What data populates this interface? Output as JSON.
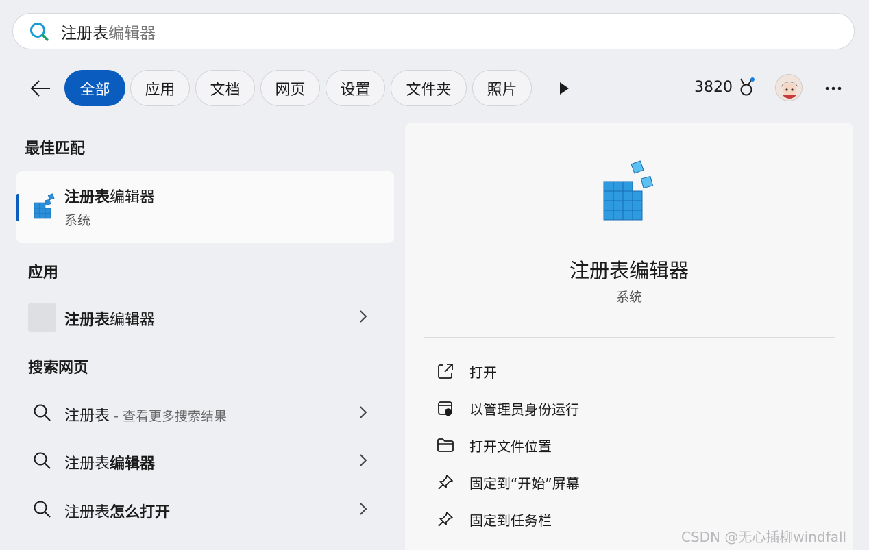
{
  "search": {
    "query_typed": "注册表",
    "query_suggest": "编辑器",
    "value": "注册表编辑器"
  },
  "filters": {
    "chips": [
      {
        "label": "全部",
        "active": true
      },
      {
        "label": "应用"
      },
      {
        "label": "文档"
      },
      {
        "label": "网页"
      },
      {
        "label": "设置"
      },
      {
        "label": "文件夹"
      },
      {
        "label": "照片"
      }
    ],
    "points": "3820"
  },
  "left": {
    "best_match_title": "最佳匹配",
    "best_match": {
      "name_bold": "注册表",
      "name_rest": "编辑器",
      "subtitle": "系统"
    },
    "apps_title": "应用",
    "apps": [
      {
        "name_bold": "注册表",
        "name_rest": "编辑器"
      }
    ],
    "web_title": "搜索网页",
    "web_results": [
      {
        "plain": "注册表",
        "hint": " - 查看更多搜索结果"
      },
      {
        "plain": "注册表",
        "bold": "编辑器"
      },
      {
        "plain": "注册表",
        "bold": "怎么打开"
      }
    ]
  },
  "detail": {
    "name": "注册表编辑器",
    "kind": "系统",
    "actions": [
      {
        "label": "打开",
        "icon": "open-external-icon"
      },
      {
        "label": "以管理员身份运行",
        "icon": "shield-admin-icon"
      },
      {
        "label": "打开文件位置",
        "icon": "folder-icon"
      },
      {
        "label": "固定到“开始”屏幕",
        "icon": "pin-icon"
      },
      {
        "label": "固定到任务栏",
        "icon": "pin-icon"
      }
    ]
  },
  "watermark": "CSDN @无心插柳windfall",
  "colors": {
    "accent": "#0a5cbe",
    "search_icon": "#1a9bd7",
    "registry_blue": "#2a8fd8"
  }
}
